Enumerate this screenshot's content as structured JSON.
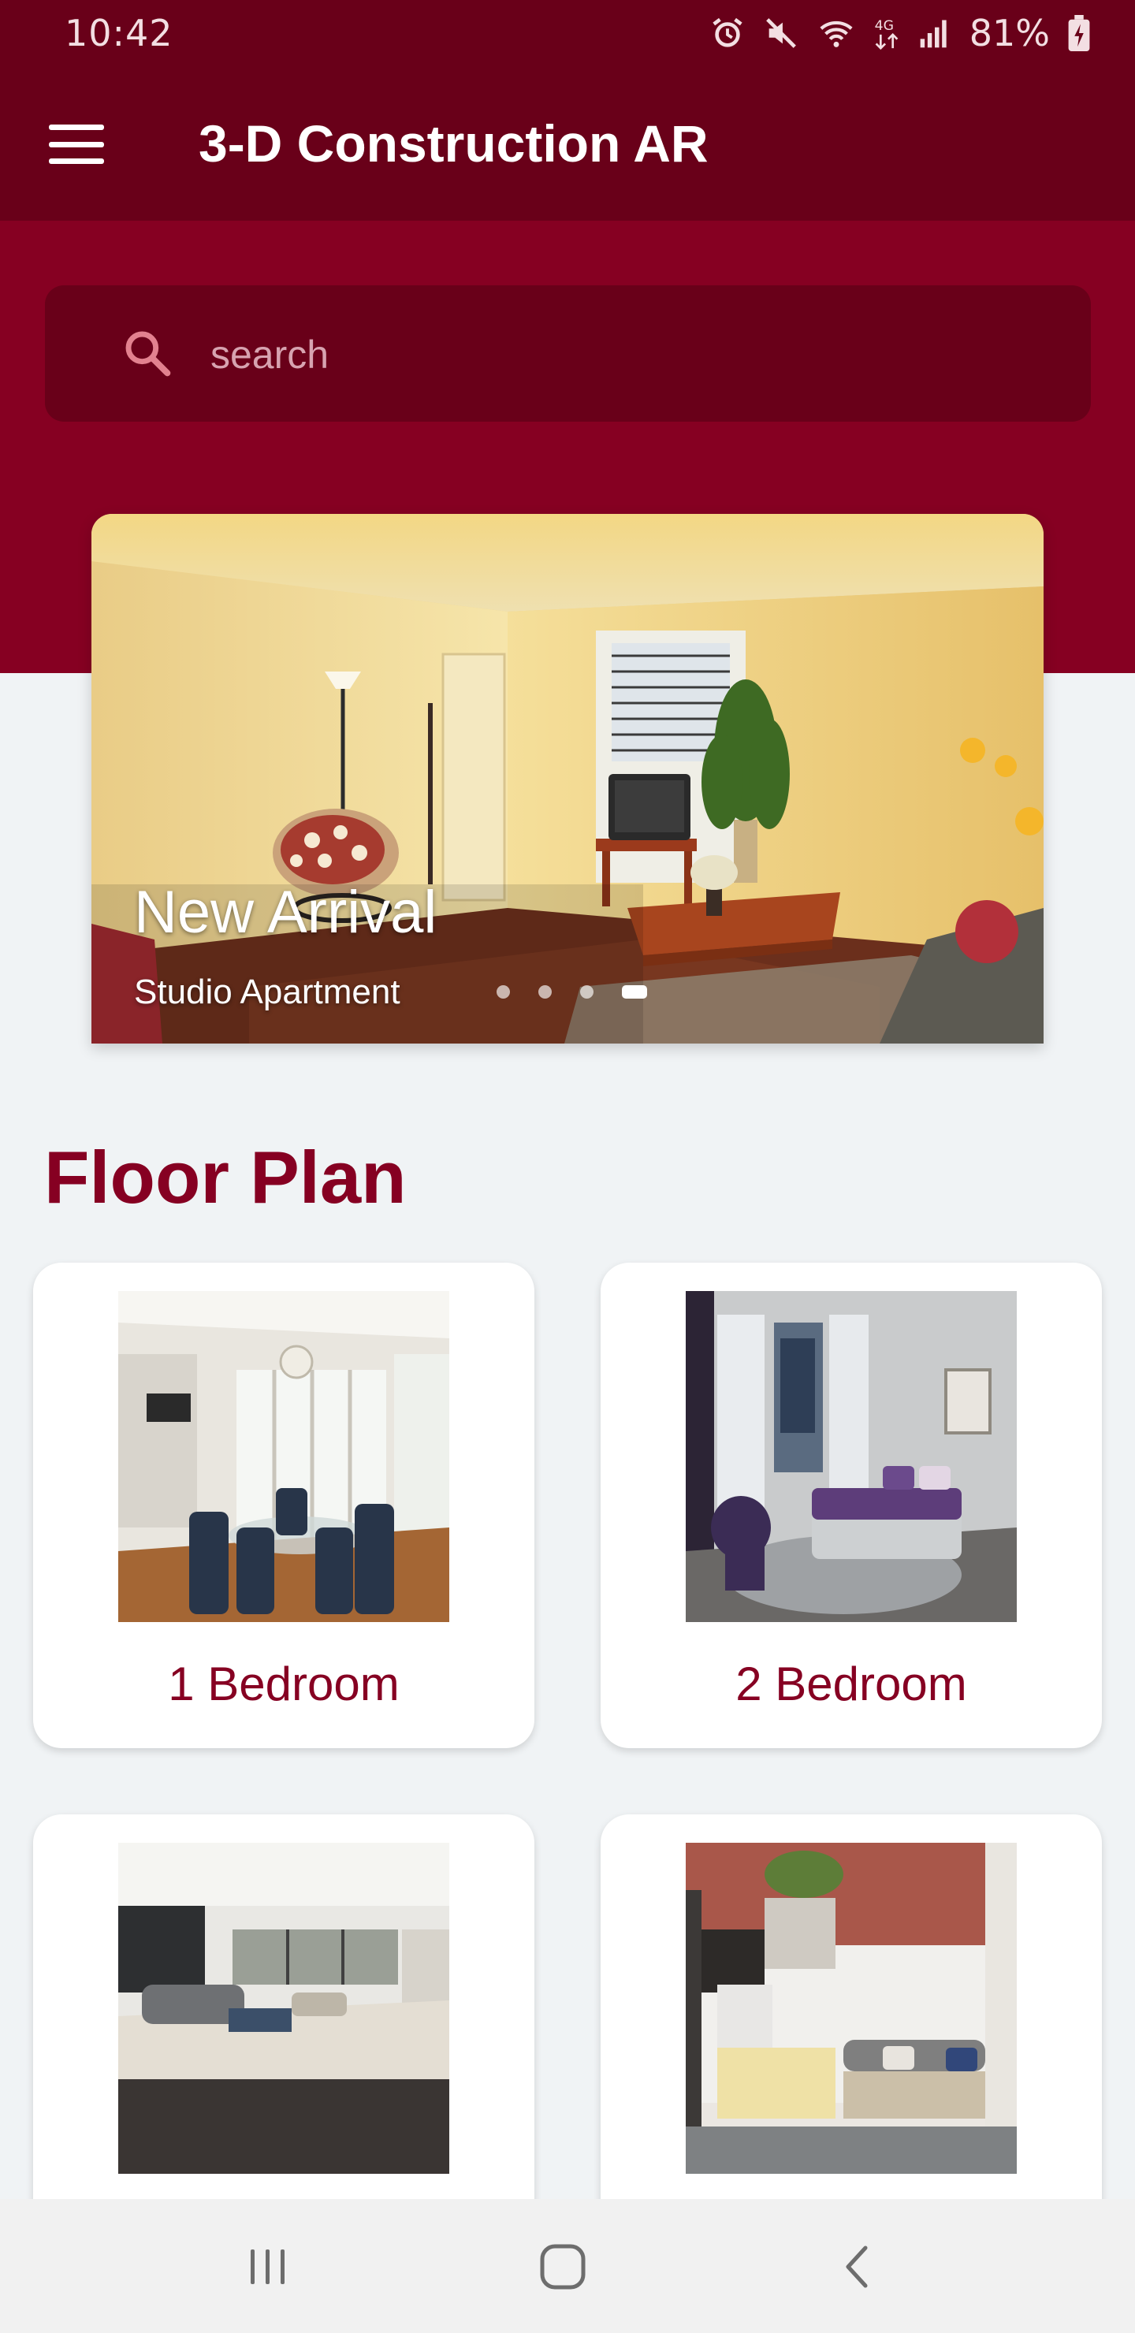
{
  "status_bar": {
    "time": "10:42",
    "battery": "81%",
    "icons": [
      "alarm-icon",
      "mute-icon",
      "wifi-icon",
      "4g-icon",
      "signal-icon",
      "battery-charging-icon"
    ]
  },
  "app_bar": {
    "title": "3-D Construction AR",
    "menu_icon": "hamburger-menu-icon"
  },
  "search": {
    "placeholder": "search",
    "value": ""
  },
  "carousel": {
    "title": "New Arrival",
    "subtitle": "Studio Apartment",
    "dot_count": 4,
    "active_index": 3
  },
  "floor_plan": {
    "title": "Floor Plan",
    "cards": [
      {
        "label": "1 Bedroom"
      },
      {
        "label": "2 Bedroom"
      },
      {
        "label": ""
      },
      {
        "label": ""
      }
    ]
  },
  "nav_bar": {
    "buttons": [
      "recents-icon",
      "home-icon",
      "back-icon"
    ]
  },
  "colors": {
    "primary_dark": "#690019",
    "primary": "#860022",
    "background": "#f0f3f5"
  }
}
